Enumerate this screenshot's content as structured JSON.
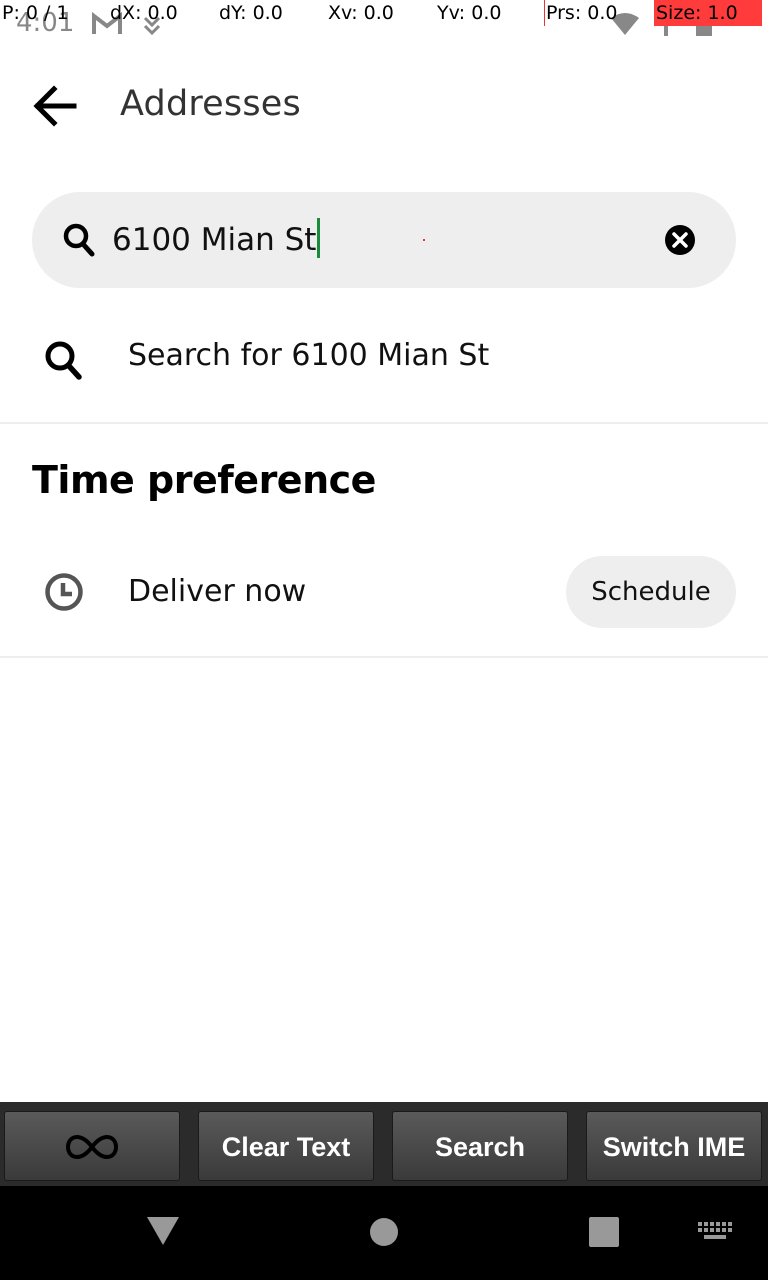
{
  "status_bar": {
    "time": "4:01",
    "icons": [
      "gmail-icon",
      "download-icon",
      "wifi-icon",
      "signal-icon",
      "battery-icon"
    ]
  },
  "debug_overlay": {
    "p": "P: 0 / 1",
    "dx": "dX: 0.0",
    "dy": "dY: 0.0",
    "xv": "Xv: 0.0",
    "yv": "Yv: 0.0",
    "prs": "Prs: 0.0",
    "size": "Size: 1.0"
  },
  "header": {
    "title": "Addresses"
  },
  "search": {
    "value": "6100 Mian St"
  },
  "suggestion": {
    "label": "Search for 6100 Mian St"
  },
  "time_preference": {
    "title": "Time preference",
    "option_label": "Deliver now",
    "schedule_label": "Schedule"
  },
  "ime_bar": {
    "clear_text": "Clear Text",
    "search": "Search",
    "switch_ime": "Switch IME"
  },
  "colors": {
    "accent_caret": "#1a8a3c",
    "field_bg": "#eeeeee"
  }
}
